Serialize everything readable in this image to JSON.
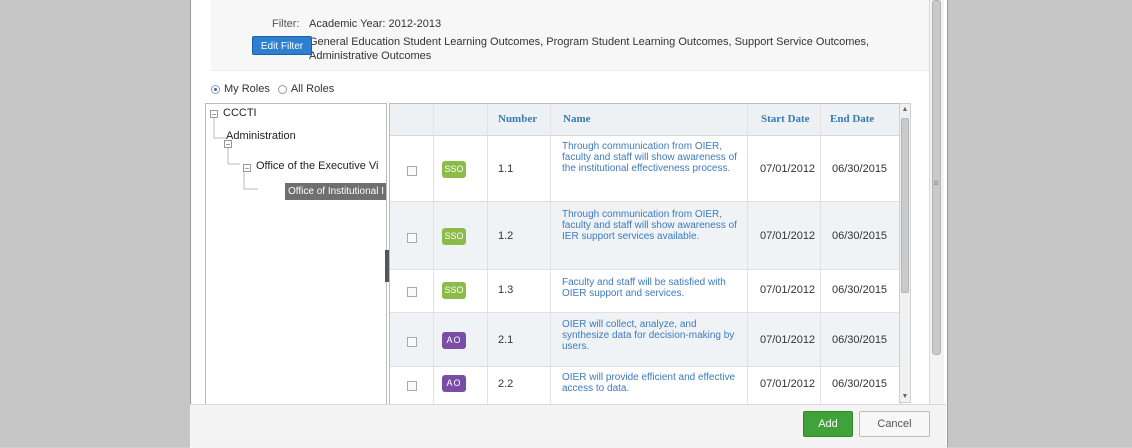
{
  "filter": {
    "label": "Filter:",
    "year": "Academic Year: 2012-2013",
    "outcomes": "General Education Student Learning Outcomes, Program Student Learning Outcomes, Support Service Outcomes, Administrative Outcomes",
    "edit_button": "Edit Filter"
  },
  "roles": {
    "my_roles": "My Roles",
    "all_roles": "All Roles",
    "selected": "My Roles"
  },
  "tree": {
    "root": "CCCTI",
    "level1": "Administration",
    "level2": "Office of the Executive Vi",
    "level3": "Office of Institutional I"
  },
  "grid": {
    "headers": {
      "number": "Number",
      "name": "Name",
      "start": "Start Date",
      "end": "End Date"
    },
    "rows": [
      {
        "badge": "SSO",
        "number": "1.1",
        "name": "Through communication from OIER, faculty and staff will show awareness of the institutional effectiveness process.",
        "start": "07/01/2012",
        "end": "06/30/2015"
      },
      {
        "badge": "SSO",
        "number": "1.2",
        "name": "Through communication from OIER, faculty and staff will show awareness of IER support services available.",
        "start": "07/01/2012",
        "end": "06/30/2015"
      },
      {
        "badge": "SSO",
        "number": "1.3",
        "name": "Faculty and staff will be satisfied with OIER support and services.",
        "start": "07/01/2012",
        "end": "06/30/2015"
      },
      {
        "badge": "AO",
        "number": "2.1",
        "name": "OIER will collect, analyze, and synthesize data for decision-making by users.",
        "start": "07/01/2012",
        "end": "06/30/2015"
      },
      {
        "badge": "AO",
        "number": "2.2",
        "name": "OIER will provide efficient and effective access to data.",
        "start": "07/01/2012",
        "end": "06/30/2015"
      }
    ]
  },
  "footer": {
    "add": "Add",
    "cancel": "Cancel"
  },
  "colors": {
    "sso_badge": "#8dbb4a",
    "ao_badge": "#7b4ea6",
    "add_button": "#3fa339",
    "edit_button": "#2d7fd0",
    "link": "#3d7ac0"
  }
}
